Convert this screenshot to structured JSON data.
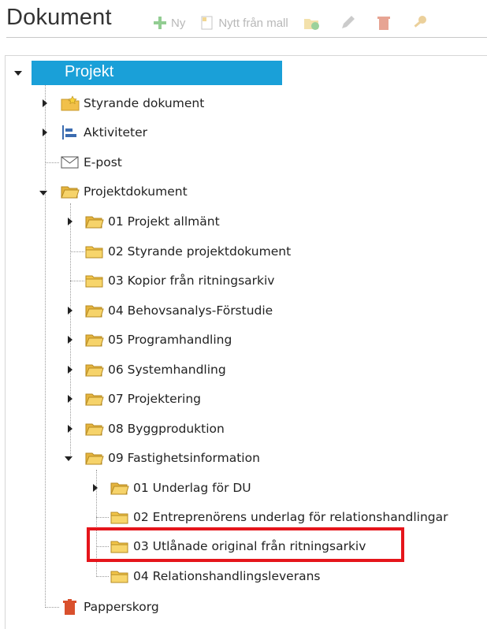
{
  "header": {
    "title": "Dokument",
    "toolbar": {
      "new_label": "Ny",
      "new_from_template_label": "Nytt från mall",
      "icons": [
        "add-icon",
        "template-icon",
        "add-folder-icon",
        "edit-icon",
        "delete-icon",
        "key-icon"
      ]
    }
  },
  "tree": {
    "root": "Projekt",
    "items": [
      {
        "label": "Styrande dokument",
        "icon": "folder-star-icon"
      },
      {
        "label": "Aktiviteter",
        "icon": "activities-icon"
      },
      {
        "label": "E-post",
        "icon": "mail-icon"
      },
      {
        "label": "Projektdokument",
        "icon": "folder-open-icon"
      },
      {
        "label": "01 Projekt allmänt",
        "icon": "folder-open-icon"
      },
      {
        "label": "02 Styrande projektdokument",
        "icon": "folder-icon"
      },
      {
        "label": "03 Kopior från ritningsarkiv",
        "icon": "folder-icon"
      },
      {
        "label": "04 Behovsanalys-Förstudie",
        "icon": "folder-open-icon"
      },
      {
        "label": "05 Programhandling",
        "icon": "folder-open-icon"
      },
      {
        "label": "06 Systemhandling",
        "icon": "folder-open-icon"
      },
      {
        "label": "07 Projektering",
        "icon": "folder-open-icon"
      },
      {
        "label": "08 Byggproduktion",
        "icon": "folder-open-icon"
      },
      {
        "label": "09 Fastighetsinformation",
        "icon": "folder-open-icon"
      },
      {
        "label": "01 Underlag för DU",
        "icon": "folder-open-icon"
      },
      {
        "label": "02 Entreprenörens underlag för relationshandlingar",
        "icon": "folder-icon"
      },
      {
        "label": "03 Utlånade original från ritningsarkiv",
        "icon": "folder-icon"
      },
      {
        "label": "04 Relationshandlingsleverans",
        "icon": "folder-icon"
      },
      {
        "label": "Papperskorg",
        "icon": "trash-icon"
      }
    ]
  },
  "colors": {
    "selection": "#1aa0d8",
    "highlight_border": "#e5151b",
    "folder": "#f3c64a"
  }
}
